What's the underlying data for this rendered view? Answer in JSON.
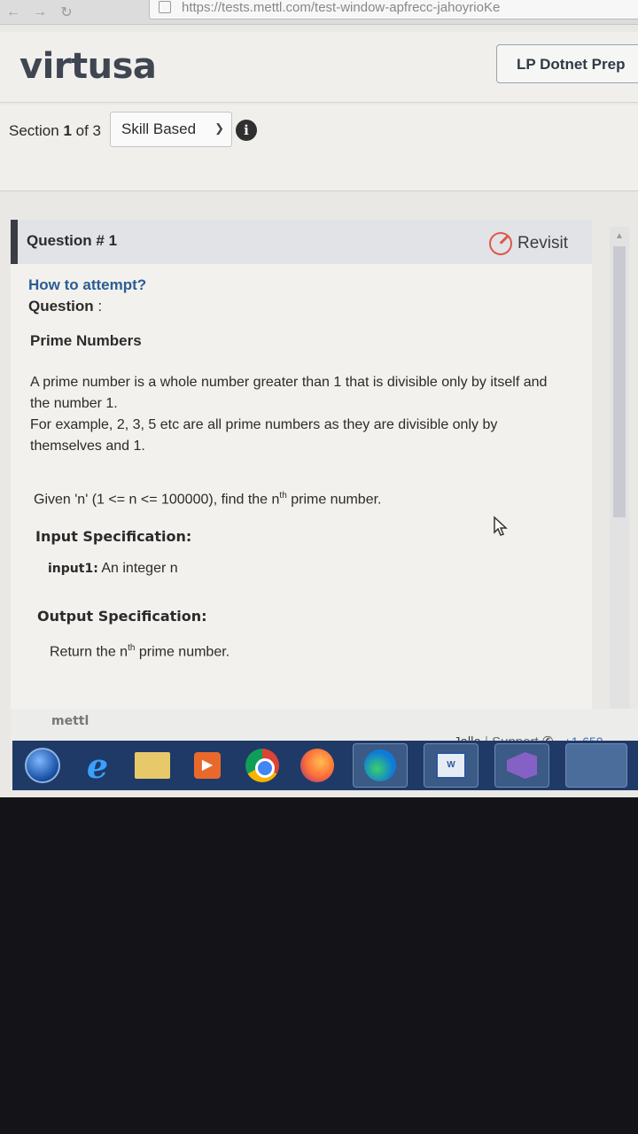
{
  "browser": {
    "url": "https://tests.mettl.com/test-window-apfrecc-jahoyrioKe"
  },
  "header": {
    "logo": "virtusa",
    "test_name": "LP Dotnet Prep"
  },
  "section": {
    "prefix": "Section",
    "current": "1",
    "of_text": "of 3",
    "selected": "Skill Based"
  },
  "question": {
    "title": "Question # 1",
    "revisit_label": "Revisit",
    "how_to": "How to attempt?",
    "question_label": "Question",
    "question_colon": ":",
    "problem_title": "Prime Numbers",
    "para1": "A prime number is a whole number greater than 1 that is divisible only by itself and the number 1.",
    "para2": "For example, 2, 3, 5 etc are all prime numbers as they are divisible only by themselves and 1.",
    "given_pre": "Given 'n' (1 <= n <= 100000), find the n",
    "given_sup": "th",
    "given_post": " prime number.",
    "input_spec_title": "Input Specification:",
    "input_label": "input1:",
    "input_desc": " An integer n",
    "output_spec_title": "Output Specification:",
    "output_pre": "Return the n",
    "output_sup": "th",
    "output_post": " prime number."
  },
  "footer": {
    "logo": "mettl",
    "company": "Jalla",
    "separator": "|",
    "support": "Support",
    "phone": "+1-650-"
  },
  "taskbar": {
    "icons": [
      "start-orb",
      "internet-explorer",
      "file-explorer",
      "media-player",
      "chrome",
      "firefox",
      "edge",
      "word",
      "visual-studio",
      "app"
    ]
  }
}
